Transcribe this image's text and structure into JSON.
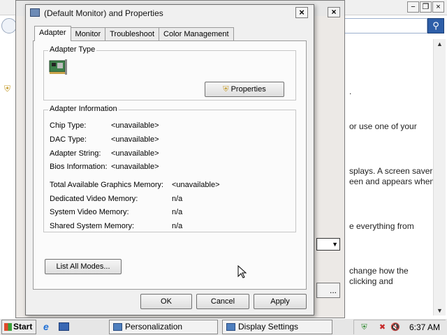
{
  "background_window": {
    "controls": [
      "−",
      "❐",
      "×"
    ],
    "search_icon": "search-icon",
    "text_lines": [
      ".",
      "or use one of your",
      "splays. A screen saver",
      "een and appears when",
      "e everything from",
      "change how the",
      "clicking and"
    ]
  },
  "middle_window": {
    "close": "×",
    "small_button": "..."
  },
  "dialog": {
    "title": "(Default Monitor) and  Properties",
    "close": "×",
    "tabs": [
      {
        "label": "Adapter",
        "active": true
      },
      {
        "label": "Monitor",
        "active": false
      },
      {
        "label": "Troubleshoot",
        "active": false
      },
      {
        "label": "Color Management",
        "active": false
      }
    ],
    "adapter_type": {
      "group_label": "Adapter Type",
      "properties_button": "Properties"
    },
    "adapter_info": {
      "group_label": "Adapter Information",
      "rows": [
        {
          "label": "Chip Type:",
          "value": "<unavailable>"
        },
        {
          "label": "DAC Type:",
          "value": "<unavailable>"
        },
        {
          "label": "Adapter String:",
          "value": "<unavailable>"
        },
        {
          "label": "Bios Information:",
          "value": "<unavailable>"
        }
      ],
      "memory_rows": [
        {
          "label": "Total Available Graphics Memory:",
          "value": "<unavailable>"
        },
        {
          "label": "Dedicated Video Memory:",
          "value": "n/a"
        },
        {
          "label": "System Video Memory:",
          "value": "n/a"
        },
        {
          "label": "Shared System Memory:",
          "value": "n/a"
        }
      ]
    },
    "list_all_modes": "List All Modes...",
    "buttons": {
      "ok": "OK",
      "cancel": "Cancel",
      "apply": "Apply"
    }
  },
  "taskbar": {
    "start": "Start",
    "tasks": [
      {
        "label": "Personalization"
      },
      {
        "label": "Display Settings"
      }
    ],
    "clock": "6:37 AM"
  }
}
